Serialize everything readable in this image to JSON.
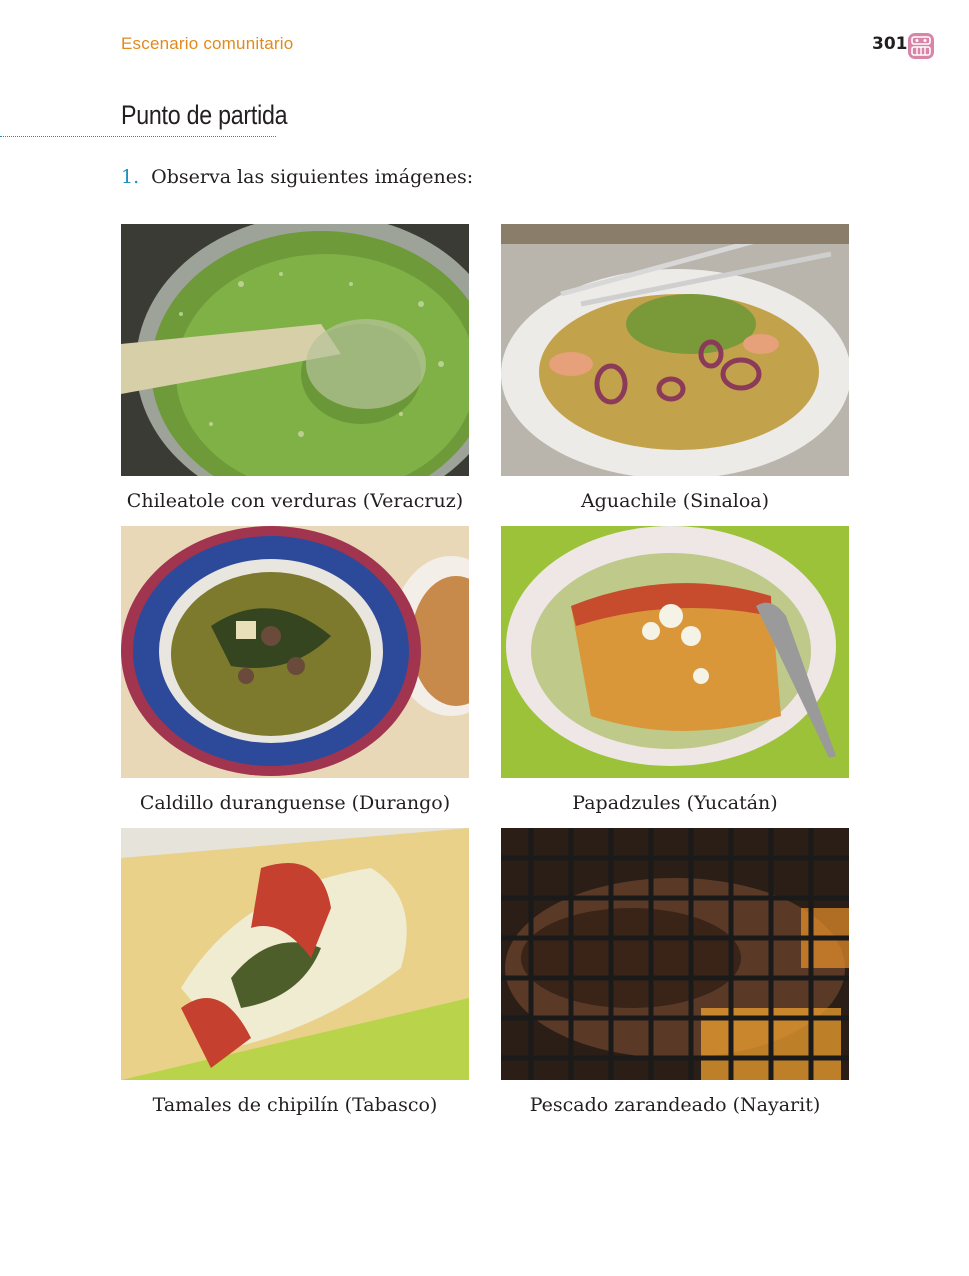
{
  "header": {
    "section_label": "Escenario comunitario",
    "page_number": "301",
    "icon": "glyph-icon"
  },
  "title": "Punto de partida",
  "instruction": {
    "number": "1.",
    "text": "Observa las siguientes imágenes:"
  },
  "colors": {
    "accent_orange": "#e08a1e",
    "accent_blue": "#1e8fc1",
    "icon_pink": "#d985a8"
  },
  "gallery": [
    {
      "caption": "Chileatole con verduras (Veracruz)"
    },
    {
      "caption": "Aguachile (Sinaloa)"
    },
    {
      "caption": "Caldillo duranguense (Durango)"
    },
    {
      "caption": "Papadzules (Yucatán)"
    },
    {
      "caption": "Tamales de chipilín (Tabasco)"
    },
    {
      "caption": "Pescado zarandeado (Nayarit)"
    }
  ]
}
